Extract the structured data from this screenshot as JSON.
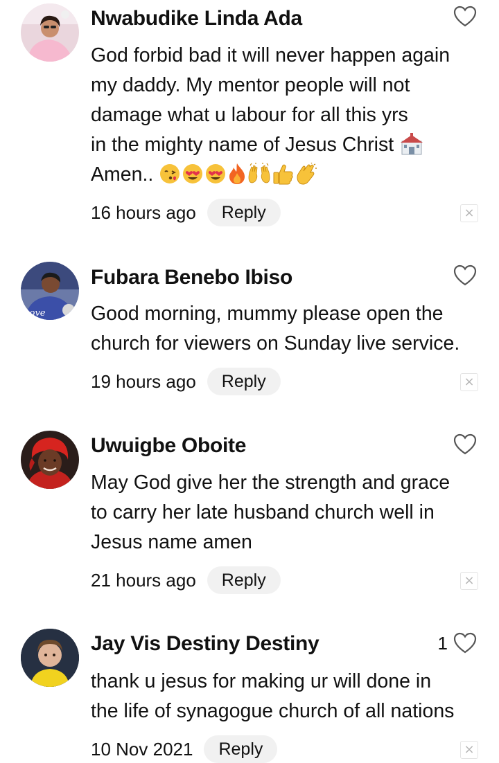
{
  "comments": [
    {
      "author": "Nwabudike Linda Ada",
      "lines": [
        "God forbid bad it will never happen again",
        "my daddy. My mentor people will not",
        "damage  what u labour for all this yrs",
        "in the mighty name of Jesus Christ",
        "Amen.."
      ],
      "emojis_line4": [
        "church"
      ],
      "emojis_line5": [
        "face-blowing-kiss",
        "smiling-heart-eyes",
        "smiling-heart-eyes",
        "fire",
        "raising-hands",
        "thumbs-up",
        "clapping-hands"
      ],
      "time": "16 hours ago",
      "reply_label": "Reply",
      "likes": "",
      "close_label": "×"
    },
    {
      "author": "Fubara Benebo Ibiso",
      "lines": [
        "Good morning,  mummy please open the",
        "church for viewers on Sunday live service."
      ],
      "avatar_text": "Love",
      "time": "19 hours ago",
      "reply_label": "Reply",
      "likes": "",
      "close_label": "×"
    },
    {
      "author": "Uwuigbe Oboite",
      "lines": [
        "May God give her the strength and grace",
        "to carry her late husband church well in",
        "Jesus name amen"
      ],
      "time": "21 hours ago",
      "reply_label": "Reply",
      "likes": "",
      "close_label": "×"
    },
    {
      "author": "Jay Vis Destiny Destiny",
      "lines": [
        "thank u jesus for making ur will done in",
        "the life of synagogue church of all nations"
      ],
      "time": "10 Nov 2021",
      "reply_label": "Reply",
      "likes": "1",
      "close_label": "×"
    }
  ],
  "colors": {
    "text": "#111111",
    "reply_bg": "#f1f1f1",
    "heart_stroke": "#555555",
    "close_border": "#e4e4e4",
    "close_glyph": "#b5b5b5"
  }
}
